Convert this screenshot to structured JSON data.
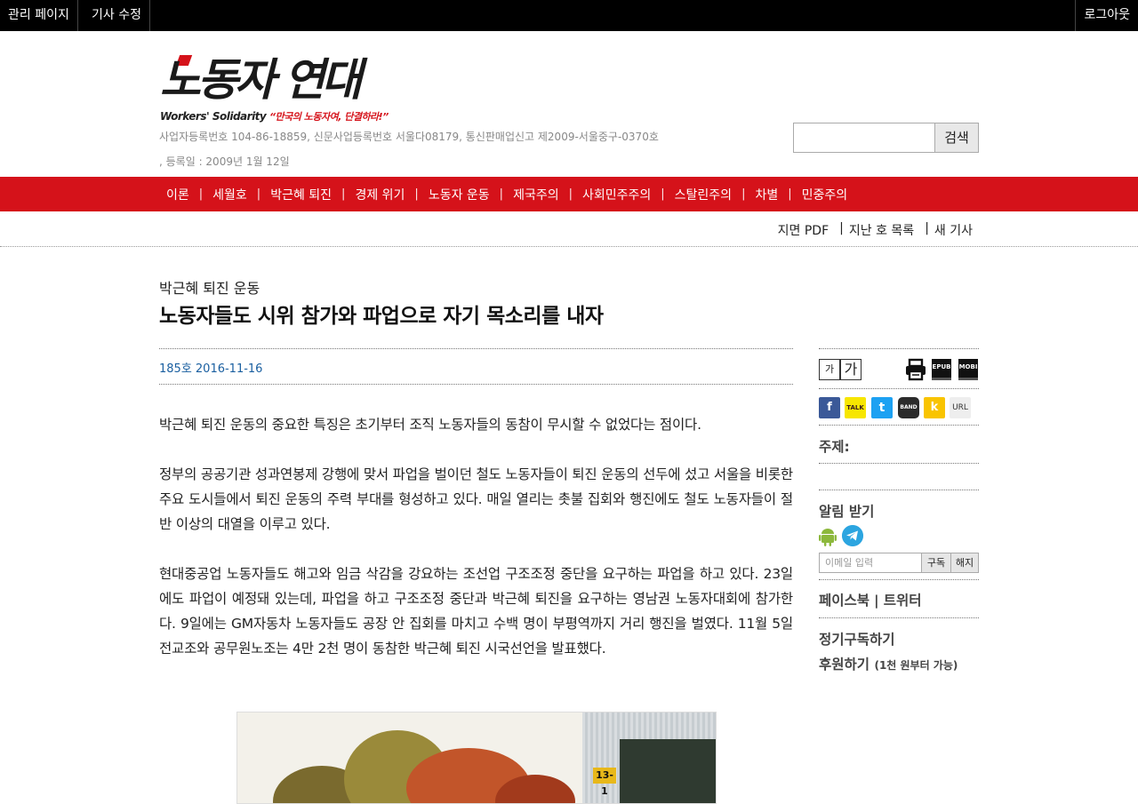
{
  "adminbar": {
    "admin_page": "관리 페이지",
    "edit_article": "기사 수정",
    "logout": "로그아웃"
  },
  "header": {
    "logo_text": "노동자 연대",
    "logo_sub": "Workers' Solidarity",
    "logo_slogan": "“만국의 노동자여, 단결하라!”",
    "registration": "사업자등록번호 104-86-18859, 신문사업등록번호 서울다08179, 통신판매업신고 제2009-서울중구-0370호",
    "registration_date": ", 등록일 : 2009년 1월 12일",
    "search_placeholder": "",
    "search_button": "검색"
  },
  "nav": {
    "items": [
      "이론",
      "세월호",
      "박근혜 퇴진",
      "경제 위기",
      "노동자 운동",
      "제국주의",
      "사회민주주의",
      "스탈린주의",
      "차별",
      "민중주의"
    ],
    "separator": "|"
  },
  "subnav": {
    "pdf": "지면 PDF",
    "back_issues": "지난 호 목록",
    "new_articles": "새 기사"
  },
  "article": {
    "kicker": "박근혜 퇴진 운동",
    "title": "노동자들도 시위 참가와 파업으로 자기 목소리를 내자",
    "meta": "185호 2016-11-16",
    "paragraphs": [
      "박근혜 퇴진 운동의 중요한 특징은 초기부터 조직 노동자들의 동참이 무시할 수 없었다는 점이다.",
      "정부의 공공기관 성과연봉제 강행에 맞서 파업을 벌이던 철도 노동자들이 퇴진 운동의 선두에 섰고 서울을 비롯한 주요 도시들에서 퇴진 운동의 주력 부대를 형성하고 있다. 매일 열리는 촛불 집회와 행진에도 철도 노동자들이 절반 이상의 대열을 이루고 있다.",
      "현대중공업 노동자들도 해고와 임금 삭감을 강요하는 조선업 구조조정 중단을 요구하는 파업을 하고 있다. 23일에도 파업이 예정돼 있는데, 파업을 하고 구조조정 중단과 박근혜 퇴진을 요구하는 영남권 노동자대회에 참가한다. 9일에는 GM자동차 노동자들도 공장 안 집회를 마치고 수백 명이 부평역까지 거리 행진을 벌였다. 11월 5일 전교조와 공무원노조는 4만 2천 명이 동참한 박근혜 퇴진 시국선언을 발표했다."
    ],
    "photo_sign": "13-1"
  },
  "sidebar": {
    "font_small": "가",
    "font_big": "가",
    "epub": "EPUB",
    "mobi": "MOBI",
    "share": {
      "facebook": "f",
      "kakaotalk": "TALK",
      "twitter": "t",
      "band": "BAND",
      "kakaostory": "k",
      "url": "URL"
    },
    "topic_label": "주제:",
    "alerts_title": "알림 받기",
    "email_placeholder": "이메일 입력",
    "subscribe": "구독",
    "unsubscribe": "해지",
    "facebook": "페이스북",
    "twitter": "트위터",
    "link_separator": "|",
    "subscribe_paper": "정기구독하기",
    "donate": "후원하기",
    "donate_note": "(1천 원부터 가능)"
  }
}
